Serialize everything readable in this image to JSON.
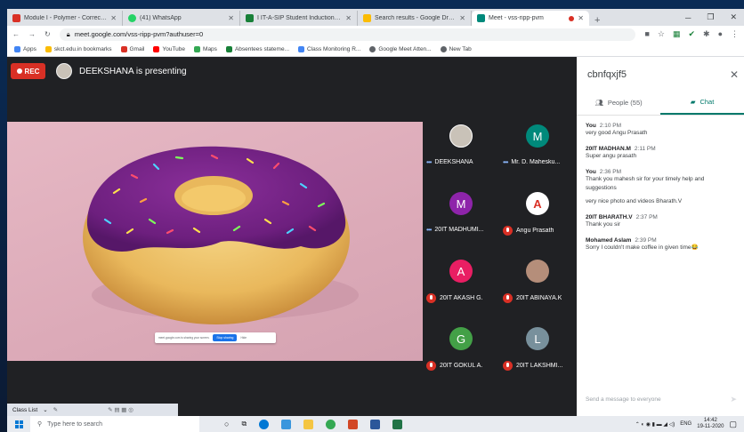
{
  "browser": {
    "tabs": [
      {
        "title": "Module I - Polymer - Corrected",
        "fav_color": "#d93025"
      },
      {
        "title": "(41) WhatsApp",
        "fav_color": "#25d366"
      },
      {
        "title": "I IT-A-SIP Student Induction Prog",
        "fav_color": "#188038"
      },
      {
        "title": "Search results - Google Drive",
        "fav_color": "#fbbc04"
      },
      {
        "title": "Meet - vss-ripp-pvm",
        "fav_color": "#00897b"
      }
    ],
    "url": "meet.google.com/vss-ripp-pvm?authuser=0",
    "bookmarks": [
      {
        "label": "Apps",
        "color": "#4285f4"
      },
      {
        "label": "skct.edu.in bookmarks",
        "color": "#fbbc04"
      },
      {
        "label": "Gmail",
        "color": "#d93025"
      },
      {
        "label": "YouTube",
        "color": "#ff0000"
      },
      {
        "label": "Maps",
        "color": "#34a853"
      },
      {
        "label": "Absentees stateme...",
        "color": "#188038"
      },
      {
        "label": "Class Monitoring R...",
        "color": "#4285f4"
      },
      {
        "label": "Google Meet Atten...",
        "color": "#5f6368"
      },
      {
        "label": "New Tab",
        "color": "#5f6368"
      }
    ]
  },
  "meet": {
    "rec_label": "REC",
    "presenting_text": "DEEKSHANA is presenting",
    "share_notice": "meet.google.com is sharing your screen.",
    "stop_sharing": "Stop sharing",
    "hide": "Hide",
    "participants": [
      {
        "name": "DEEKSHANA",
        "initial": "",
        "color": "#c9c2b8",
        "muted": false
      },
      {
        "name": "Mr. D. Mahesku...",
        "initial": "M",
        "color": "#00897b",
        "muted": false
      },
      {
        "name": "20IT MADHUMI...",
        "initial": "M",
        "color": "#8e24aa",
        "muted": false
      },
      {
        "name": "Angu Prasath",
        "initial": "A",
        "color": "#ffffff",
        "muted": true
      },
      {
        "name": "20IT AKASH G.",
        "initial": "A",
        "color": "#e91e63",
        "muted": true
      },
      {
        "name": "20IT ABINAYA.K",
        "initial": "",
        "color": "#b58e7a",
        "muted": true
      },
      {
        "name": "20IT GOKUL A.",
        "initial": "G",
        "color": "#43a047",
        "muted": true
      },
      {
        "name": "20IT LAKSHMI...",
        "initial": "L",
        "color": "#78909c",
        "muted": true
      }
    ]
  },
  "panel": {
    "title": "cbnfqxjf5",
    "tab_people": "People (55)",
    "tab_chat": "Chat",
    "messages": [
      {
        "sender": "You",
        "time": "2:10 PM",
        "lines": [
          "very good Angu Prasath"
        ]
      },
      {
        "sender": "20IT MADHAN.M",
        "time": "2:11 PM",
        "lines": [
          "Super angu prasath"
        ]
      },
      {
        "sender": "You",
        "time": "2:36 PM",
        "lines": [
          "Thank you mahesh sir for your timely help and",
          "suggestions",
          "",
          "very nice photo and videos Bharath.V"
        ]
      },
      {
        "sender": "20IT BHARATH.V",
        "time": "2:37 PM",
        "lines": [
          "Thank you sir"
        ]
      },
      {
        "sender": "Mohamed Aslam",
        "time": "2:39 PM",
        "lines": [
          "Sorry I couldn't make coffee in given time😂"
        ]
      }
    ],
    "compose_placeholder": "Send a message to everyone"
  },
  "classlist": {
    "label": "Class List"
  },
  "taskbar": {
    "search_placeholder": "Type here to search",
    "lang": "ENG",
    "time": "14:42",
    "date": "19-11-2020"
  }
}
